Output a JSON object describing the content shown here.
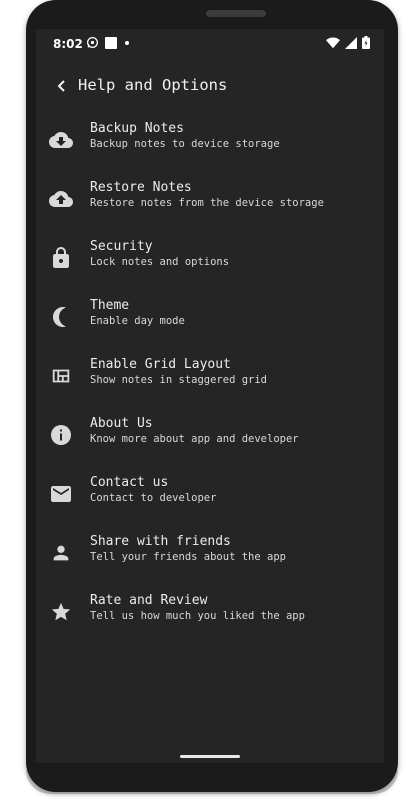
{
  "status_bar": {
    "time": "8:02",
    "left_icons": [
      "whatsapp-icon",
      "notification-square-icon",
      "dot-icon"
    ],
    "right_icons": [
      "wifi-icon",
      "signal-icon",
      "battery-icon"
    ]
  },
  "header": {
    "title": "Help and Options",
    "back_icon": "chevron-left-icon"
  },
  "menu": {
    "items": [
      {
        "title": "Backup Notes",
        "subtitle": "Backup notes to device storage",
        "icon": "cloud-download-icon"
      },
      {
        "title": "Restore Notes",
        "subtitle": "Restore notes from the device storage",
        "icon": "cloud-upload-icon"
      },
      {
        "title": "Security",
        "subtitle": "Lock notes and options",
        "icon": "lock-icon"
      },
      {
        "title": "Theme",
        "subtitle": "Enable day mode",
        "icon": "moon-icon"
      },
      {
        "title": "Enable Grid Layout",
        "subtitle": "Show notes in staggered grid",
        "icon": "grid-icon"
      },
      {
        "title": "About Us",
        "subtitle": "Know more about app and developer",
        "icon": "info-icon"
      },
      {
        "title": "Contact us",
        "subtitle": "Contact to developer",
        "icon": "mail-icon"
      },
      {
        "title": "Share with friends",
        "subtitle": "Tell your friends about the app",
        "icon": "person-icon"
      },
      {
        "title": "Rate and Review",
        "subtitle": "Tell us how much you liked the app",
        "icon": "star-icon"
      }
    ]
  },
  "colors": {
    "screen_background": "#252525",
    "text_primary": "#ececec",
    "icon_color": "#d9d9d9"
  }
}
